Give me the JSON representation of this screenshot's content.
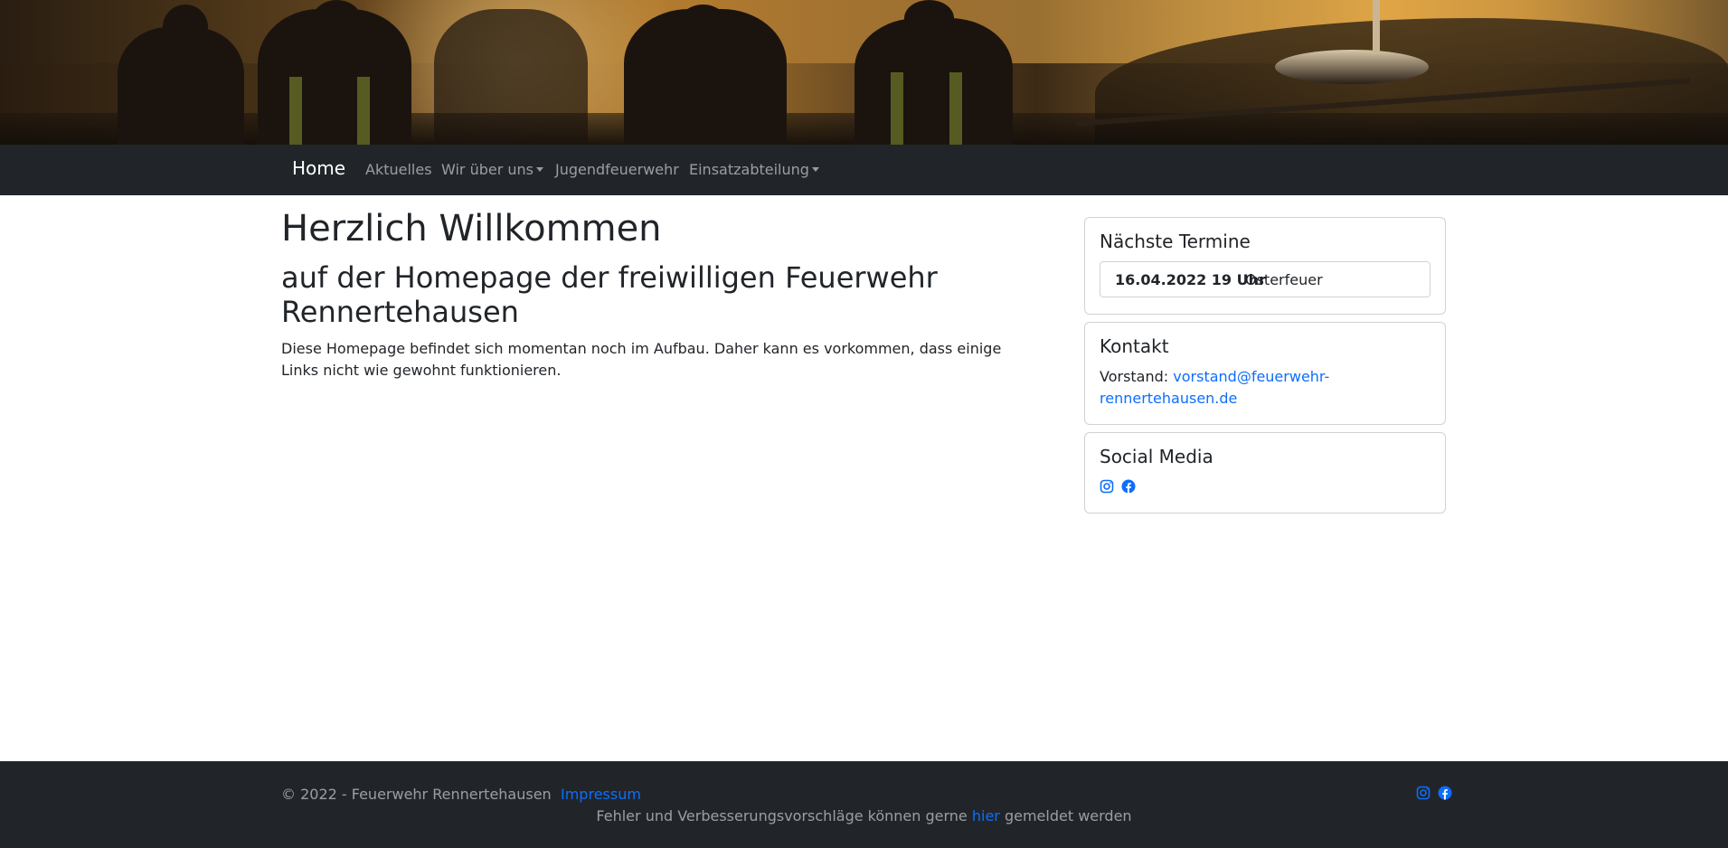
{
  "nav": {
    "brand": "Home",
    "items": [
      {
        "label": "Aktuelles"
      },
      {
        "label": "Wir über uns"
      },
      {
        "label": "Jugendfeuerwehr"
      },
      {
        "label": "Einsatzabteilung"
      }
    ]
  },
  "main": {
    "title": "Herzlich Willkommen",
    "subtitle": "auf der Homepage der freiwilligen Feuerwehr Rennertehausen",
    "text": "Diese Homepage befindet sich momentan noch im Aufbau. Daher kann es vorkommen, dass einige Links nicht wie gewohnt funktionieren."
  },
  "sidebar": {
    "termine": {
      "title": "Nächste Termine",
      "items": [
        {
          "date": "16.04.2022 19 Uhr",
          "name": "Osterfeuer"
        }
      ]
    },
    "kontakt": {
      "title": "Kontakt",
      "label": "Vorstand:",
      "email": "vorstand@feuerwehr-rennertehausen.de"
    },
    "social": {
      "title": "Social Media",
      "icons": [
        "instagram-icon",
        "facebook-icon"
      ]
    }
  },
  "footer": {
    "copyright": "© 2022 - Feuerwehr Rennertehausen",
    "impressum": "Impressum",
    "note_before": "Fehler und Verbesserungsvorschläge können gerne",
    "note_link": "hier",
    "note_after": "gemeldet werden",
    "icons": [
      "instagram-icon",
      "facebook-icon"
    ]
  },
  "colors": {
    "navbar_bg": "#212529",
    "link": "#0d6efd",
    "text": "#212529"
  }
}
